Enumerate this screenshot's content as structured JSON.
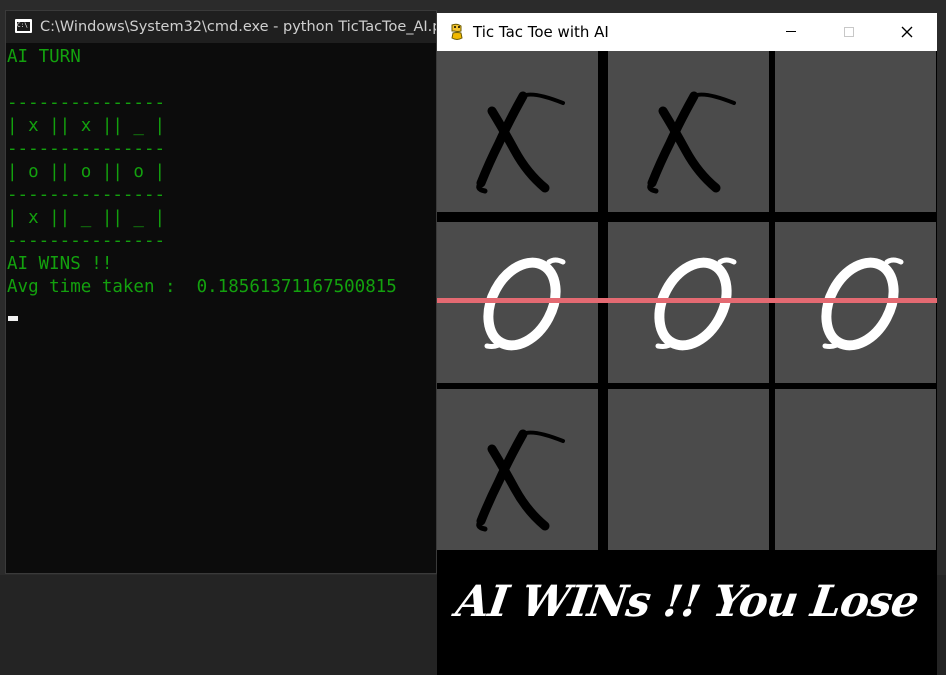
{
  "cmd": {
    "title": "C:\\Windows\\System32\\cmd.exe - python  TicTacToe_AI.py",
    "lines": [
      "AI TURN",
      "",
      "---------------",
      "| x || x || _ |",
      "---------------",
      "| o || o || o |",
      "---------------",
      "| x || _ || _ |",
      "---------------",
      "AI WINS !!",
      "Avg time taken :  0.18561371167500815"
    ],
    "text_color": "#13a10e"
  },
  "game": {
    "title": "Tic Tac Toe with AI",
    "board": [
      [
        "X",
        "X",
        ""
      ],
      [
        "O",
        "O",
        "O"
      ],
      [
        "X",
        "",
        ""
      ]
    ],
    "winning_row": 1,
    "banner": "AI WINs !! You Lose",
    "colors": {
      "cell": "#4b4b4b",
      "win_line": "#e46a72",
      "x_mark": "#000000",
      "o_mark": "#ffffff"
    },
    "icon": "pygame-snake-icon"
  }
}
